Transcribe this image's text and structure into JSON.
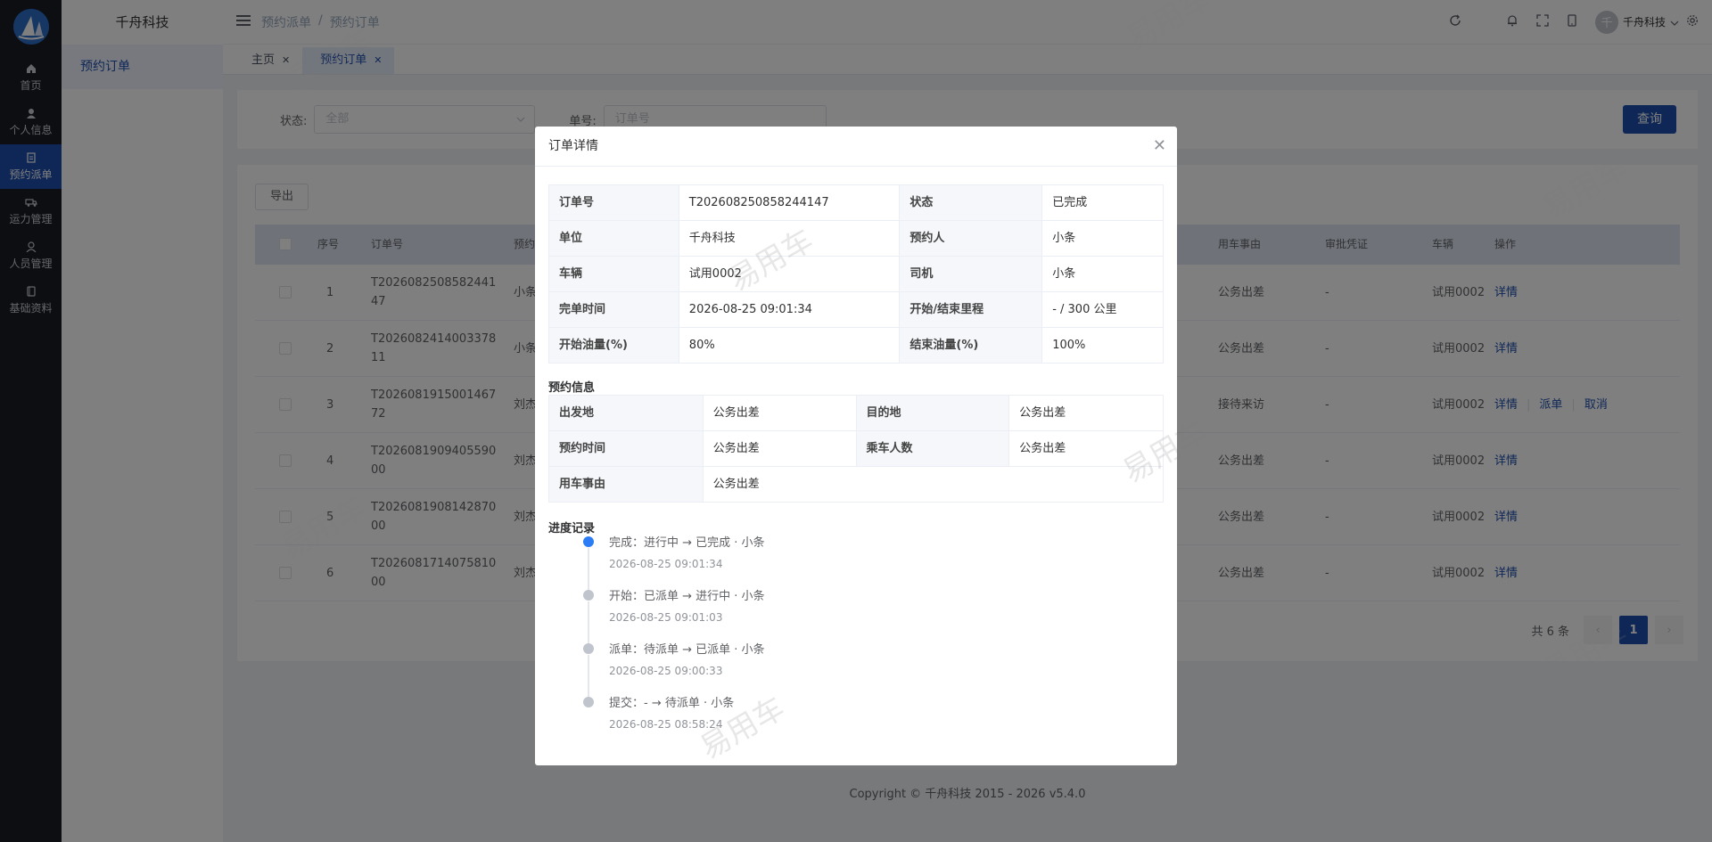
{
  "sidebar": {
    "items": [
      {
        "label": "首页",
        "icon": "home-icon"
      },
      {
        "label": "个人信息",
        "icon": "user-icon"
      },
      {
        "label": "预约派单",
        "icon": "document-icon"
      },
      {
        "label": "运力管理",
        "icon": "truck-icon"
      },
      {
        "label": "人员管理",
        "icon": "people-icon"
      },
      {
        "label": "基础资料",
        "icon": "book-icon"
      }
    ]
  },
  "subnav": {
    "brand": "千舟科技",
    "item": "预约订单"
  },
  "header": {
    "crumbs": [
      "预约派单",
      "/",
      "预约订单"
    ],
    "user": "千舟科技",
    "avatar_letter": "千"
  },
  "tabs": [
    {
      "label": "主页"
    },
    {
      "label": "预约订单"
    }
  ],
  "filter": {
    "status_label": "状态:",
    "status_value": "全部",
    "order_label": "单号:",
    "order_placeholder": "订单号",
    "query": "查询"
  },
  "table": {
    "export": "导出",
    "headers": {
      "index": "序号",
      "order": "订单号",
      "booker": "预约",
      "reason": "用车事由",
      "approval": "审批凭证",
      "vehicle": "车辆",
      "action": "操作"
    },
    "rows": [
      {
        "index": "1",
        "order1": "T2026082508582441",
        "order2": "47",
        "booker": "小条",
        "reason": "公务出差",
        "approval": "-",
        "vehicle": "试用0002"
      },
      {
        "index": "2",
        "order1": "T2026082414003378",
        "order2": "11",
        "booker": "小条",
        "reason": "公务出差",
        "approval": "-",
        "vehicle": "试用0002"
      },
      {
        "index": "3",
        "order1": "T2026081915001467",
        "order2": "72",
        "booker": "刘杰",
        "reason": "接待来访",
        "approval": "-",
        "vehicle": "试用0002"
      },
      {
        "index": "4",
        "order1": "T2026081909405590",
        "order2": "00",
        "booker": "刘杰",
        "reason": "公务出差",
        "approval": "-",
        "vehicle": "试用0002"
      },
      {
        "index": "5",
        "order1": "T2026081908142870",
        "order2": "00",
        "booker": "刘杰",
        "reason": "公务出差",
        "approval": "-",
        "vehicle": "试用0002"
      },
      {
        "index": "6",
        "order1": "T2026081714075810",
        "order2": "00",
        "booker": "刘杰",
        "reason": "公务出差",
        "approval": "-",
        "vehicle": "试用0002"
      }
    ],
    "actions": {
      "detail": "详情",
      "dispatch": "派单",
      "cancel": "取消"
    }
  },
  "pager": {
    "total": "共 6 条",
    "current": "1"
  },
  "footer": "Copyright © 千舟科技 2015 - 2026 v5.4.0",
  "watermark": "易用车",
  "dialog": {
    "title": "订单详情",
    "info": [
      [
        "订单号",
        "T202608250858244147",
        "状态",
        "已完成"
      ],
      [
        "单位",
        "千舟科技",
        "预约人",
        "小条"
      ],
      [
        "车辆",
        "试用0002",
        "司机",
        "小条"
      ],
      [
        "完单时间",
        "2026-08-25 09:01:34",
        "开始/结束里程",
        "- / 300 公里"
      ],
      [
        "开始油量(%)",
        "80%",
        "结束油量(%)",
        "100%"
      ]
    ],
    "booking_title": "预约信息",
    "booking": [
      [
        "出发地",
        "公务出差",
        "目的地",
        "公务出差"
      ],
      [
        "预约时间",
        "公务出差",
        "乘车人数",
        "公务出差"
      ]
    ],
    "reason_label": "用车事由",
    "reason_value": "公务出差",
    "progress_title": "进度记录",
    "progress": [
      {
        "text": "完成：进行中 → 已完成 · 小条",
        "time": "2026-08-25 09:01:34"
      },
      {
        "text": "开始：已派单 → 进行中 · 小条",
        "time": "2026-08-25 09:01:03"
      },
      {
        "text": "派单：待派单 → 已派单 · 小条",
        "time": "2026-08-25 09:00:33"
      },
      {
        "text": "提交：- → 待派单 · 小条",
        "time": "2026-08-25 08:58:24"
      }
    ]
  }
}
